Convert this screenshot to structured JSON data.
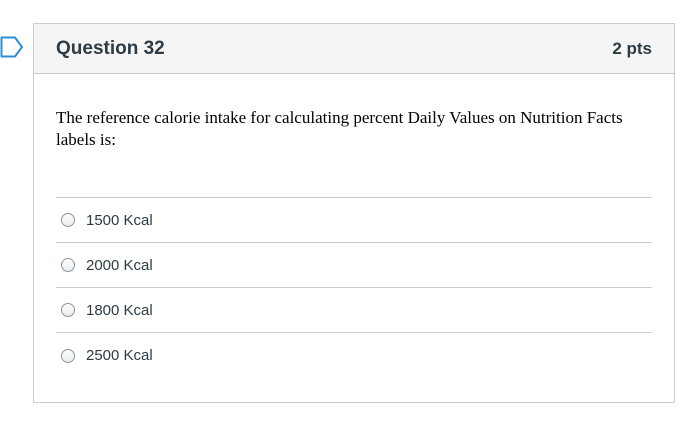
{
  "question": {
    "title": "Question 32",
    "points": "2 pts",
    "text": "The reference calorie intake for calculating percent Daily Values on Nutrition Facts labels is:",
    "answers": [
      {
        "label": "1500 Kcal",
        "selected": false
      },
      {
        "label": "2000 Kcal",
        "selected": false
      },
      {
        "label": "1800 Kcal",
        "selected": false
      },
      {
        "label": "2500 Kcal",
        "selected": false
      }
    ]
  },
  "colors": {
    "flag": "#2d8fd5",
    "header_bg": "#f5f5f5",
    "border": "#c7cdd1",
    "text": "#2d3b45"
  },
  "icons": {
    "flag": "flag-question-icon"
  }
}
